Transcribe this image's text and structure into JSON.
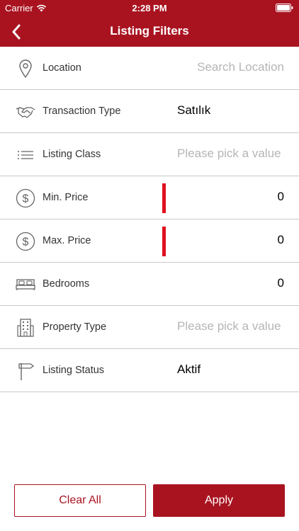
{
  "status_bar": {
    "carrier": "Carrier",
    "time": "2:28 PM"
  },
  "nav": {
    "title": "Listing Filters"
  },
  "filters": [
    {
      "label": "Location",
      "value": "",
      "placeholder": "Search Location",
      "icon": "location-pin-icon"
    },
    {
      "label": "Transaction Type",
      "value": "Satılık",
      "placeholder": "",
      "icon": "handshake-icon"
    },
    {
      "label": "Listing Class",
      "value": "",
      "placeholder": "Please pick a value",
      "icon": "list-icon"
    },
    {
      "label": "Min. Price",
      "value": "0",
      "placeholder": "",
      "icon": "dollar-icon"
    },
    {
      "label": "Max. Price",
      "value": "0",
      "placeholder": "",
      "icon": "dollar-icon"
    },
    {
      "label": "Bedrooms",
      "value": "0",
      "placeholder": "",
      "icon": "bed-icon"
    },
    {
      "label": "Property Type",
      "value": "",
      "placeholder": "Please pick a value",
      "icon": "building-icon"
    },
    {
      "label": "Listing Status",
      "value": "Aktif",
      "placeholder": "",
      "icon": "signpost-icon"
    }
  ],
  "buttons": {
    "clear_all": "Clear All",
    "apply": "Apply"
  },
  "colors": {
    "brand": "#a91320",
    "marker": "#e0101f",
    "placeholder": "#b5b5b5",
    "divider": "#c8c8c8"
  }
}
